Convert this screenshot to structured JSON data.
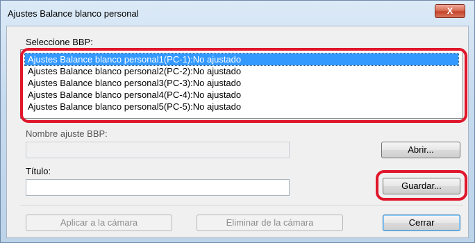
{
  "window": {
    "title": "Ajustes Balance blanco personal",
    "close_label": "X"
  },
  "labels": {
    "select_bbp": "Seleccione BBP:",
    "bbp_name": "Nombre ajuste BBP:",
    "title": "Título:"
  },
  "list": {
    "items": [
      "Ajustes Balance blanco personal1(PC-1):No ajustado",
      "Ajustes Balance blanco personal2(PC-2):No ajustado",
      "Ajustes Balance blanco personal3(PC-3):No ajustado",
      "Ajustes Balance blanco personal4(PC-4):No ajustado",
      "Ajustes Balance blanco personal5(PC-5):No ajustado"
    ],
    "selected_index": 0
  },
  "fields": {
    "bbp_name_value": "",
    "title_value": ""
  },
  "buttons": {
    "open": "Abrir...",
    "save": "Guardar...",
    "apply": "Aplicar a la cámara",
    "delete": "Eliminar de la cámara",
    "close": "Cerrar"
  },
  "colors": {
    "highlight_ring": "#e0162b",
    "selection": "#3399ff"
  }
}
